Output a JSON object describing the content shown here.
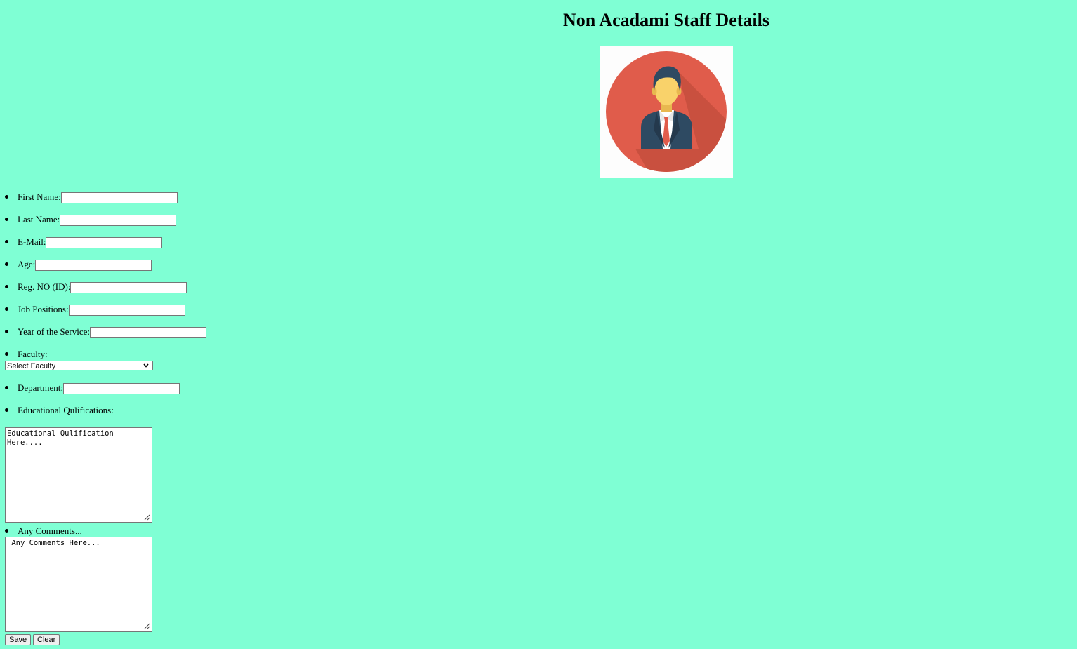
{
  "page": {
    "title": "Non Acadami Staff Details",
    "background_color": "#7fffd4"
  },
  "avatar": {
    "icon": "businessman-avatar-icon",
    "colors": {
      "circle": "#e05c4b",
      "shadow": "#c9503f",
      "face": "#f9d26a",
      "hair": "#2e4a62",
      "suit": "#2e4a62",
      "shirt": "#ffffff",
      "tie": "#e05c4b"
    }
  },
  "form": {
    "fields": [
      {
        "label": "First Name:",
        "value": ""
      },
      {
        "label": "Last Name:",
        "value": ""
      },
      {
        "label": "E-Mail:",
        "value": ""
      },
      {
        "label": "Age:",
        "value": ""
      },
      {
        "label": "Reg. NO (ID):",
        "value": ""
      },
      {
        "label": "Job Positions:",
        "value": ""
      },
      {
        "label": "Year of the Service:",
        "value": ""
      }
    ],
    "faculty": {
      "label": "Faculty:",
      "selected": "Select Faculty"
    },
    "department": {
      "label": "Department:",
      "value": ""
    },
    "education": {
      "label": "Educational Qulifications:",
      "value": "Educational Qulification Here...."
    },
    "comments": {
      "label": "Any Comments...",
      "value": " Any Comments Here..."
    },
    "buttons": {
      "save": "Save",
      "clear": "Clear"
    }
  }
}
